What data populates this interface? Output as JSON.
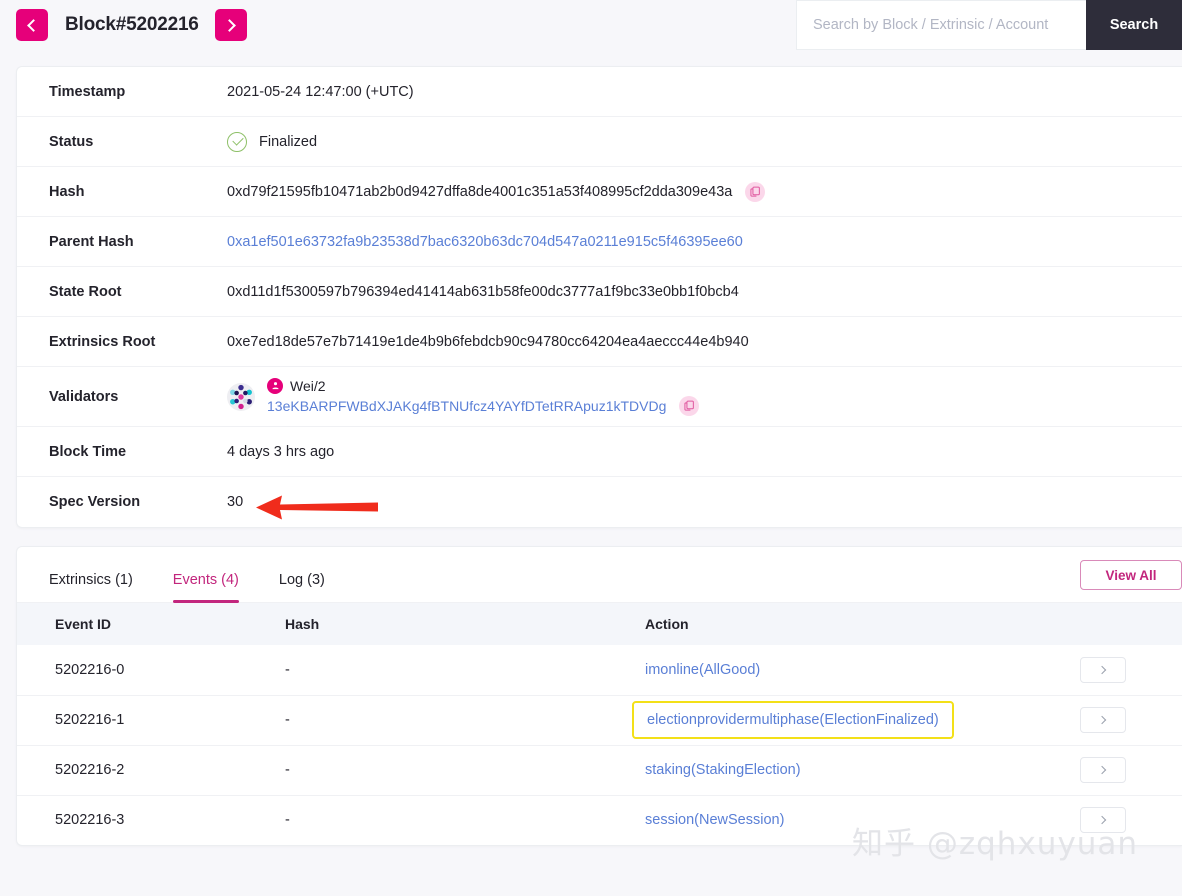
{
  "header": {
    "prev_label": "Previous block",
    "next_label": "Next block",
    "title": "Block#5202216",
    "search_placeholder": "Search by Block / Extrinsic / Account",
    "search_value": "",
    "search_button": "Search"
  },
  "detail": {
    "rows": [
      {
        "label": "Timestamp",
        "value": "2021-05-24 12:47:00 (+UTC)"
      },
      {
        "label": "Status",
        "value": "Finalized"
      },
      {
        "label": "Hash",
        "value": "0xd79f21595fb10471ab2b0d9427dffa8de4001c351a53f408995cf2dda309e43a"
      },
      {
        "label": "Parent Hash",
        "value": "0xa1ef501e63732fa9b23538d7bac6320b63dc704d547a0211e915c5f46395ee60"
      },
      {
        "label": "State Root",
        "value": "0xd11d1f5300597b796394ed41414ab631b58fe00dc3777a1f9bc33e0bb1f0bcb4"
      },
      {
        "label": "Extrinsics Root",
        "value": "0xe7ed18de57e7b71419e1de4b9b6febdcb90c94780cc64204ea4aeccc44e4b940"
      },
      {
        "label": "Validators",
        "value": ""
      },
      {
        "label": "Block Time",
        "value": "4 days 3 hrs ago"
      },
      {
        "label": "Spec Version",
        "value": "30"
      }
    ],
    "validator": {
      "name": "Wei/2",
      "address": "13eKBARPFWBdXJAKg4fBTNUfcz4YAYfDTetRRApuz1kTDVDg"
    }
  },
  "tabs": [
    {
      "label": "Extrinsics (1)",
      "active": false
    },
    {
      "label": "Events (4)",
      "active": true
    },
    {
      "label": "Log (3)",
      "active": false
    }
  ],
  "view_all_label": "View All",
  "events_table": {
    "columns": [
      "Event ID",
      "Hash",
      "Action",
      ""
    ],
    "rows": [
      {
        "id": "5202216-0",
        "hash": "-",
        "action": "imonline(AllGood)",
        "highlighted": false
      },
      {
        "id": "5202216-1",
        "hash": "-",
        "action": "electionprovidermultiphase(ElectionFinalized)",
        "highlighted": true
      },
      {
        "id": "5202216-2",
        "hash": "-",
        "action": "staking(StakingElection)",
        "highlighted": false
      },
      {
        "id": "5202216-3",
        "hash": "-",
        "action": "session(NewSession)",
        "highlighted": false
      }
    ]
  },
  "watermark": "知乎 @zqhxuyuan",
  "colors": {
    "brand_pink": "#e6007a",
    "tab_active": "#c2267d",
    "link_blue": "#5a7fd6",
    "status_green": "#8ec068",
    "highlight_yellow": "#f3e018",
    "arrow_red": "#f02c1c",
    "search_button_bg": "#2e2d3a"
  }
}
